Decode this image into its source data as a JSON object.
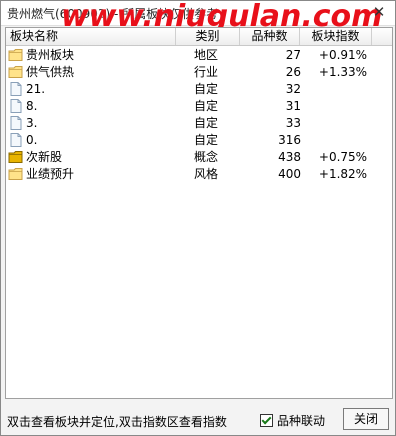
{
  "window": {
    "title": "贵州燃气(600903) - 所属板块仅供参考",
    "watermark": "www.niugulan.com"
  },
  "table": {
    "headers": [
      "板块名称",
      "类别",
      "品种数",
      "板块指数"
    ],
    "rows": [
      {
        "icon": "folder-icon",
        "name": "贵州板块",
        "type": "地区",
        "count": "27",
        "index": "+0.91%"
      },
      {
        "icon": "folder-icon",
        "name": "供气供热",
        "type": "行业",
        "count": "26",
        "index": "+1.33%"
      },
      {
        "icon": "document-icon",
        "name": "21.",
        "type": "自定",
        "count": "32",
        "index": ""
      },
      {
        "icon": "document-icon",
        "name": "8.",
        "type": "自定",
        "count": "31",
        "index": ""
      },
      {
        "icon": "document-icon",
        "name": "3.",
        "type": "自定",
        "count": "33",
        "index": ""
      },
      {
        "icon": "document-icon",
        "name": "0.",
        "type": "自定",
        "count": "316",
        "index": ""
      },
      {
        "icon": "folder-icon-dark",
        "name": "次新股",
        "type": "概念",
        "count": "438",
        "index": "+0.75%"
      },
      {
        "icon": "folder-icon",
        "name": "业绩预升",
        "type": "风格",
        "count": "400",
        "index": "+1.82%"
      }
    ]
  },
  "footer": {
    "hint": "双击查看板块并定位,双击指数区查看指数",
    "checkbox_label": "品种联动",
    "checkbox_checked": true,
    "close_label": "关闭"
  }
}
